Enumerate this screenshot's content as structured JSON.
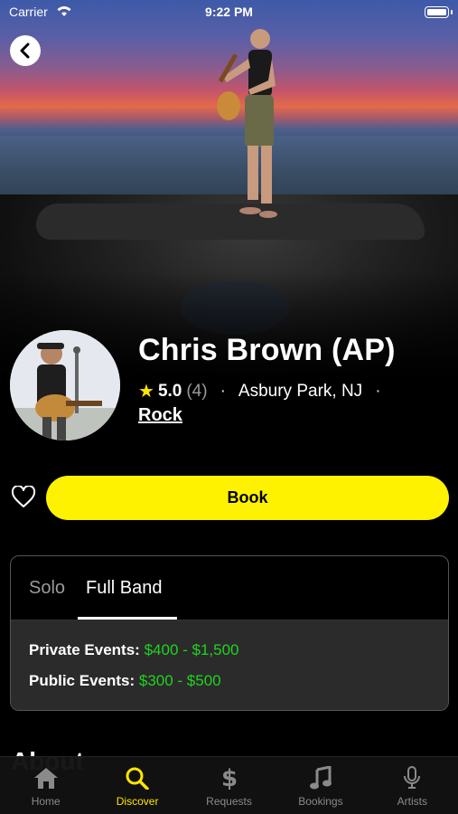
{
  "status_bar": {
    "carrier": "Carrier",
    "time": "9:22 PM"
  },
  "profile": {
    "name": "Chris Brown (AP)",
    "rating": "5.0",
    "rating_count": "(4)",
    "separator": "·",
    "location": "Asbury Park, NJ",
    "genre": "Rock"
  },
  "actions": {
    "book_label": "Book"
  },
  "pricing": {
    "tabs": [
      {
        "label": "Solo",
        "selected": false
      },
      {
        "label": "Full Band",
        "selected": true
      }
    ],
    "private_label": "Private Events:",
    "private_value": "$400 - $1,500",
    "public_label": "Public Events:",
    "public_value": "$300 - $500"
  },
  "section_peek": "About",
  "tabbar": {
    "items": [
      {
        "label": "Home",
        "icon": "home-icon",
        "active": false
      },
      {
        "label": "Discover",
        "icon": "search-icon",
        "active": true
      },
      {
        "label": "Requests",
        "icon": "dollar-icon",
        "active": false
      },
      {
        "label": "Bookings",
        "icon": "music-note-icon",
        "active": false
      },
      {
        "label": "Artists",
        "icon": "microphone-icon",
        "active": false
      }
    ]
  },
  "colors": {
    "accent": "#fff200",
    "price": "#1fd41f",
    "active_tab": "#ffe500"
  }
}
